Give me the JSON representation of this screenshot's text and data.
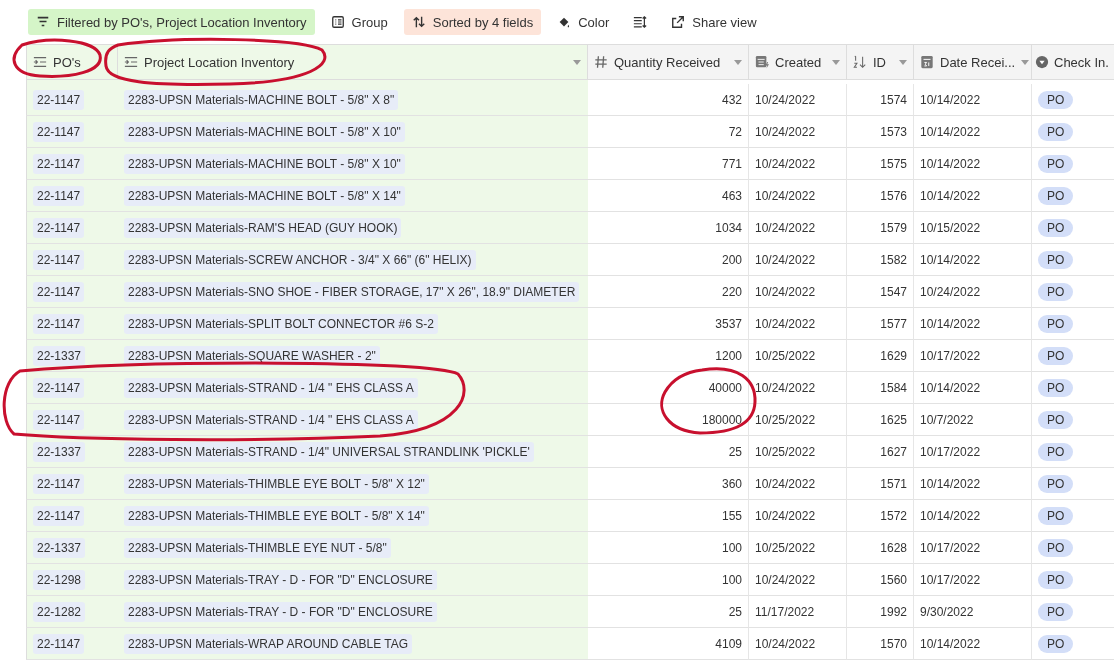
{
  "toolbar": [
    {
      "kind": "filter",
      "label": "Filtered by PO's, Project Location Inventory",
      "active": true
    },
    {
      "kind": "group",
      "label": "Group",
      "active": false
    },
    {
      "kind": "sort",
      "label": "Sorted by 4 fields",
      "active": true
    },
    {
      "kind": "color",
      "label": "Color",
      "active": false
    },
    {
      "kind": "row-height",
      "active": false
    },
    {
      "kind": "share",
      "label": "Share view",
      "active": false
    }
  ],
  "table": {
    "columns": [
      {
        "kind": "link",
        "label": "PO's",
        "filtered": true,
        "menu": false
      },
      {
        "kind": "link",
        "label": "Project Location Inventory",
        "filtered": true,
        "menu": true
      },
      {
        "kind": "number",
        "label": "Quantity Received",
        "filtered": false,
        "menu": true
      },
      {
        "kind": "created",
        "label": "Created",
        "filtered": false,
        "menu": true
      },
      {
        "kind": "autonumber",
        "label": "ID",
        "filtered": false,
        "menu": true
      },
      {
        "kind": "date",
        "label": "Date Recei...",
        "filtered": false,
        "menu": true
      },
      {
        "kind": "select",
        "label": "Check In.",
        "filtered": false
      }
    ],
    "rows": [
      [
        "22-1147",
        "2283-UPSN Materials-MACHINE BOLT - 5/8\" X 8\"",
        "432",
        "10/24/2022",
        "1574",
        "10/14/2022",
        "PO"
      ],
      [
        "22-1147",
        "2283-UPSN Materials-MACHINE BOLT - 5/8\" X 10\"",
        "72",
        "10/24/2022",
        "1573",
        "10/14/2022",
        "PO"
      ],
      [
        "22-1147",
        "2283-UPSN Materials-MACHINE BOLT - 5/8\" X 10\"",
        "771",
        "10/24/2022",
        "1575",
        "10/14/2022",
        "PO"
      ],
      [
        "22-1147",
        "2283-UPSN Materials-MACHINE BOLT - 5/8\" X 14\"",
        "463",
        "10/24/2022",
        "1576",
        "10/14/2022",
        "PO"
      ],
      [
        "22-1147",
        "2283-UPSN Materials-RAM'S HEAD (GUY HOOK)",
        "1034",
        "10/24/2022",
        "1579",
        "10/15/2022",
        "PO"
      ],
      [
        "22-1147",
        "2283-UPSN Materials-SCREW ANCHOR - 3/4\" X 66\" (6\" HELIX)",
        "200",
        "10/24/2022",
        "1582",
        "10/14/2022",
        "PO"
      ],
      [
        "22-1147",
        "2283-UPSN Materials-SNO SHOE - FIBER STORAGE, 17\" X 26\", 18.9\" DIAMETER",
        "220",
        "10/24/2022",
        "1547",
        "10/24/2022",
        "PO"
      ],
      [
        "22-1147",
        "2283-UPSN Materials-SPLIT BOLT CONNECTOR #6 S-2",
        "3537",
        "10/24/2022",
        "1577",
        "10/14/2022",
        "PO"
      ],
      [
        "22-1337",
        "2283-UPSN Materials-SQUARE WASHER - 2\"",
        "1200",
        "10/25/2022",
        "1629",
        "10/17/2022",
        "PO"
      ],
      [
        "22-1147",
        "2283-UPSN Materials-STRAND - 1/4 \" EHS CLASS A",
        "40000",
        "10/24/2022",
        "1584",
        "10/14/2022",
        "PO"
      ],
      [
        "22-1147",
        "2283-UPSN Materials-STRAND - 1/4 \" EHS CLASS A",
        "180000",
        "10/25/2022",
        "1625",
        "10/7/2022",
        "PO"
      ],
      [
        "22-1337",
        "2283-UPSN Materials-STRAND - 1/4\" UNIVERSAL STRANDLINK 'PICKLE'",
        "25",
        "10/25/2022",
        "1627",
        "10/17/2022",
        "PO"
      ],
      [
        "22-1147",
        "2283-UPSN Materials-THIMBLE EYE BOLT - 5/8\" X 12\"",
        "360",
        "10/24/2022",
        "1571",
        "10/14/2022",
        "PO"
      ],
      [
        "22-1147",
        "2283-UPSN Materials-THIMBLE EYE BOLT - 5/8\" X 14\"",
        "155",
        "10/24/2022",
        "1572",
        "10/14/2022",
        "PO"
      ],
      [
        "22-1337",
        "2283-UPSN Materials-THIMBLE EYE NUT - 5/8\"",
        "100",
        "10/25/2022",
        "1628",
        "10/17/2022",
        "PO"
      ],
      [
        "22-1298",
        "2283-UPSN Materials-TRAY - D - FOR \"D\" ENCLOSURE",
        "100",
        "10/24/2022",
        "1560",
        "10/17/2022",
        "PO"
      ],
      [
        "22-1282",
        "2283-UPSN Materials-TRAY - D - FOR \"D\" ENCLOSURE",
        "25",
        "11/17/2022",
        "1992",
        "9/30/2022",
        "PO"
      ],
      [
        "22-1147",
        "2283-UPSN Materials-WRAP AROUND CABLE TAG",
        "4109",
        "10/24/2022",
        "1570",
        "10/14/2022",
        "PO"
      ]
    ]
  }
}
